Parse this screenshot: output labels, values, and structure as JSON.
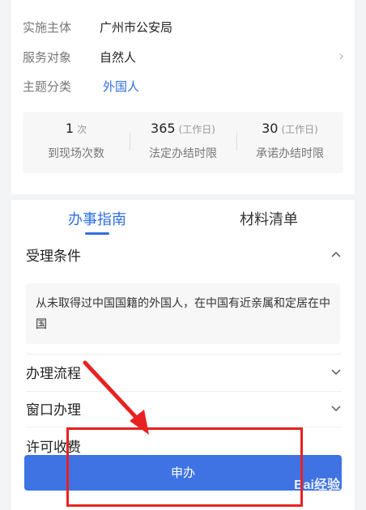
{
  "info": {
    "rows": [
      {
        "key": "实施主体",
        "value": "广州市公安局"
      },
      {
        "key": "服务对象",
        "value": "自然人"
      },
      {
        "key": "主题分类",
        "value": "外国人"
      }
    ],
    "arrow": "›"
  },
  "stats": [
    {
      "number": "1",
      "unit": "次",
      "label": "到现场次数"
    },
    {
      "number": "365",
      "unit": "(工作日)",
      "label": "法定办结时限"
    },
    {
      "number": "30",
      "unit": "(工作日)",
      "label": "承诺办结时限"
    }
  ],
  "tabs": [
    {
      "label": "办事指南",
      "active": true
    },
    {
      "label": "材料清单",
      "active": false
    }
  ],
  "sections": {
    "acceptance": {
      "title": "受理条件",
      "content": "从未取得过中国国籍的外国人，在中国有近亲属和定居在中国",
      "icon": "chevron-up-icon"
    },
    "process": {
      "title": "办理流程",
      "icon": "chevron-down-icon"
    },
    "window": {
      "title": "窗口办理",
      "icon": "chevron-down-icon"
    },
    "fee": {
      "title": "许可收费"
    }
  },
  "apply_button": {
    "label": "申办"
  },
  "watermark": "Bai经验",
  "colors": {
    "accent": "#2f6fe0",
    "button": "#3f73e4",
    "annotation": "#e82222"
  }
}
